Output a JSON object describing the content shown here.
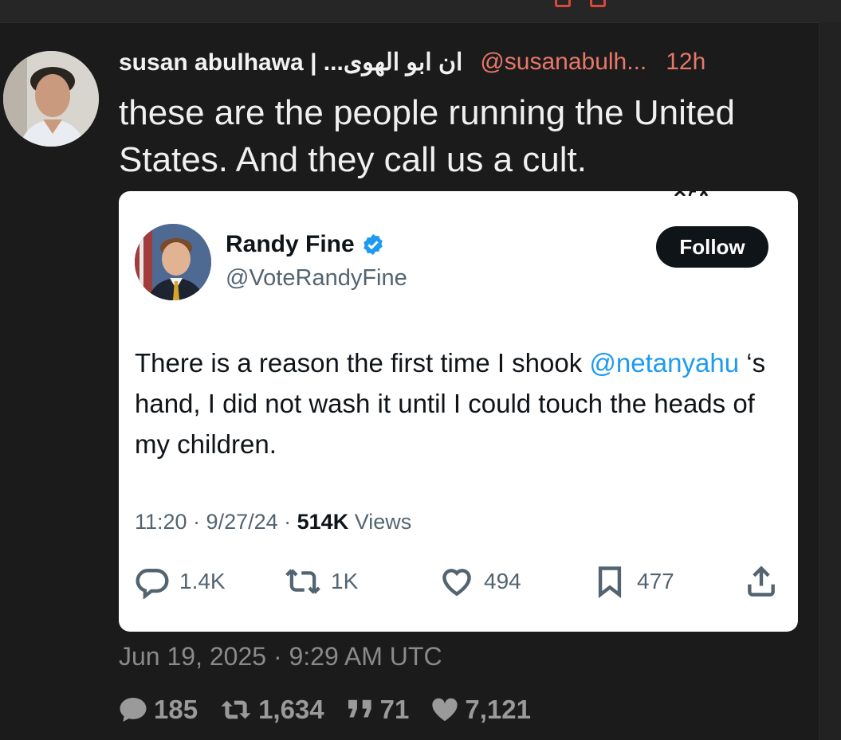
{
  "post": {
    "author_name": "susan abulhawa | ...ان ابو الهوى",
    "handle": "@susanabulh...",
    "time_ago": "12h",
    "text": "these are the people running the United States. And they call us a cult.",
    "date": "Jun 19, 2025 · 9:29 AM UTC",
    "stats": {
      "replies": "185",
      "reposts": "1,634",
      "quotes": "71",
      "likes": "7,121"
    }
  },
  "quoted": {
    "name": "Randy Fine",
    "handle": "@VoteRandyFine",
    "follow_label": "Follow",
    "text_before": "There is a reason the first time I shook ",
    "mention": "@netanyahu",
    "text_after": " ‘s hand, I did not wash it until I could touch the heads of my children.",
    "meta_time": "11:20 · 9/27/24 · ",
    "views_count": "514K",
    "views_label": " Views",
    "actions": {
      "replies": "1.4K",
      "reposts": "1K",
      "likes": "494",
      "bookmarks": "477"
    }
  },
  "colors": {
    "background": "#1b1b1b",
    "accent": "#e8776a",
    "card_bg": "#ffffff",
    "link": "#1d9bf0",
    "verified": "#1d9bf0"
  },
  "icons": [
    "reply-icon",
    "repost-icon",
    "like-icon",
    "bookmark-icon",
    "share-icon",
    "verified-icon",
    "comment-icon",
    "quote-icon",
    "heart-icon"
  ]
}
